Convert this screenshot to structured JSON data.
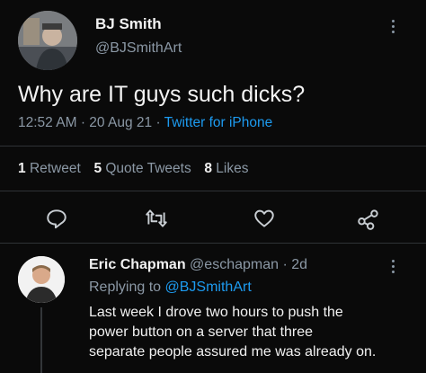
{
  "tweet": {
    "author_name": "BJ Smith",
    "author_handle": "@BJSmithArt",
    "text": "Why are IT guys such dicks?",
    "time": "12:52 AM",
    "separator_1": "·",
    "date": "20 Aug 21",
    "separator_2": "·",
    "source": "Twitter for iPhone"
  },
  "stats": {
    "retweets_count": "1",
    "retweets_label": "Retweet",
    "quotes_count": "5",
    "quotes_label": "Quote Tweets",
    "likes_count": "8",
    "likes_label": "Likes"
  },
  "actions": {
    "reply_icon": "reply-icon",
    "retweet_icon": "retweet-icon",
    "like_icon": "heart-icon",
    "share_icon": "share-icon"
  },
  "reply": {
    "author_name": "Eric Chapman",
    "author_handle": "@eschapman",
    "separator": "·",
    "time": "2d",
    "replying_prefix": "Replying to",
    "replying_handle": "@BJSmithArt",
    "text_line_1": "Last week I drove two hours to push the",
    "text_line_2": "power button on a server that three",
    "text_line_3": "separate people assured me was already on."
  },
  "colors": {
    "background": "#0a0a0a",
    "text": "#e7e9ea",
    "muted": "#8b98a5",
    "link": "#1d9bf0",
    "divider": "#2f3336"
  }
}
